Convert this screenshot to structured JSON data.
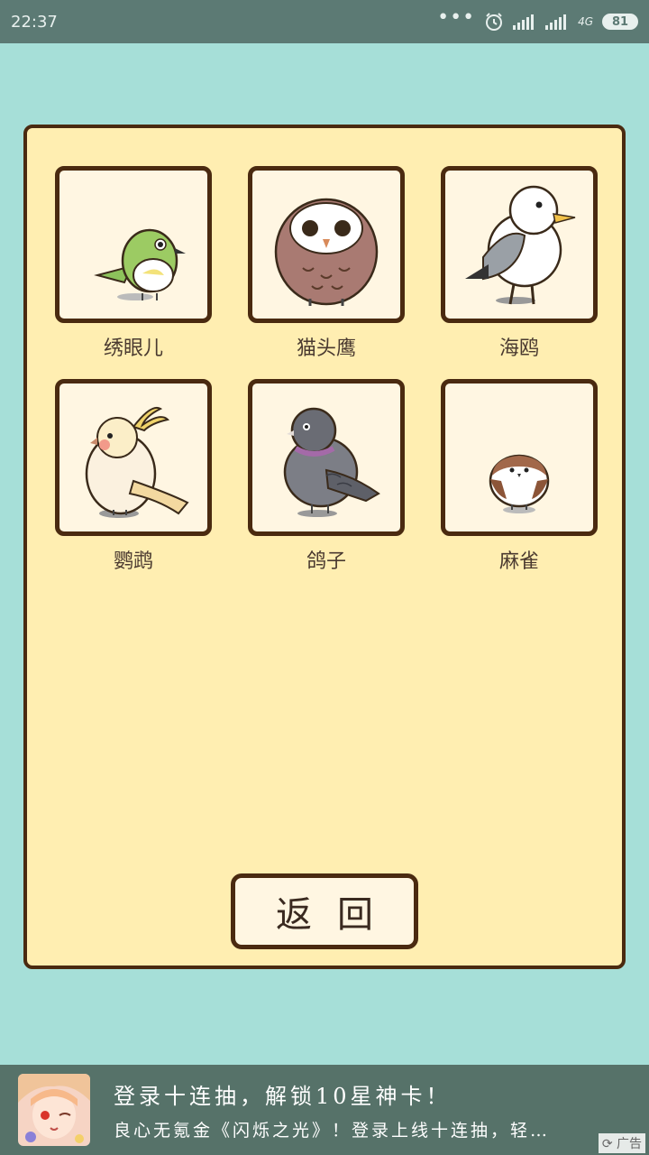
{
  "status_bar": {
    "time": "22:37",
    "dots": "•••",
    "network": "4G",
    "battery": "81"
  },
  "birds": [
    {
      "name": "绣眼儿",
      "icon": "white-eye-bird-icon"
    },
    {
      "name": "猫头鹰",
      "icon": "owl-icon"
    },
    {
      "name": "海鸥",
      "icon": "seagull-icon"
    },
    {
      "name": "鹦鹉",
      "icon": "cockatiel-icon"
    },
    {
      "name": "鸽子",
      "icon": "pigeon-icon"
    },
    {
      "name": "麻雀",
      "icon": "sparrow-icon"
    }
  ],
  "return_button": {
    "label": "返回"
  },
  "ad": {
    "title": "登录十连抽，解锁10星神卡！",
    "desc": "良心无氪金《闪烁之光》！登录上线十连抽，轻…",
    "tag": "广告"
  }
}
